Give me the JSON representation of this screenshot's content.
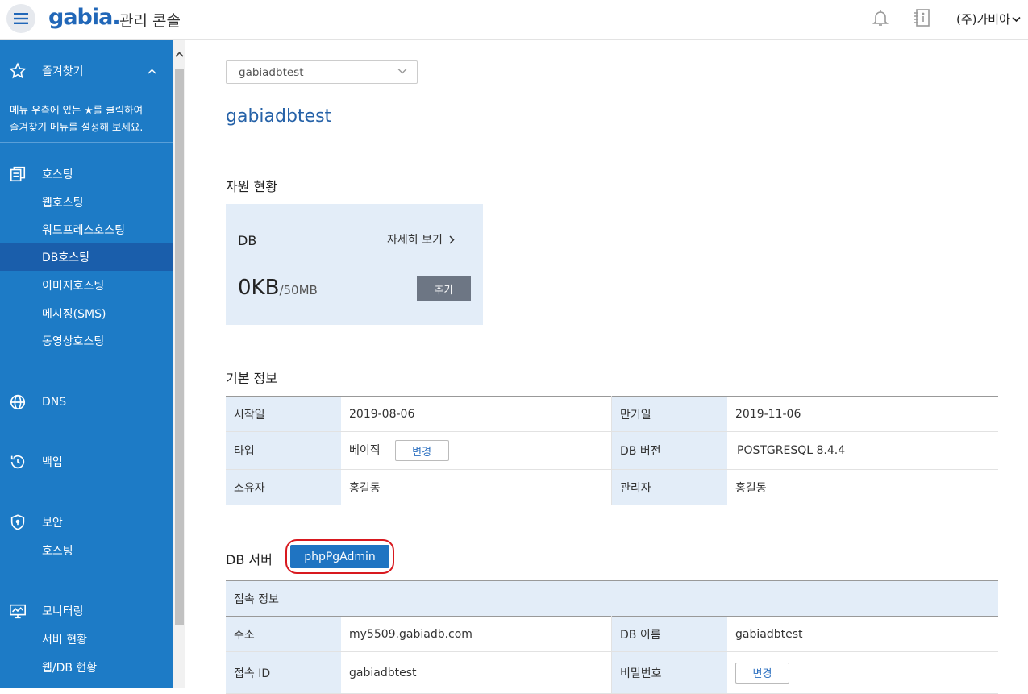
{
  "header": {
    "logo": "gabia.",
    "console_label": "관리 콘솔",
    "account": "(주)가비아"
  },
  "sidebar": {
    "favorites": {
      "label": "즐겨찾기",
      "note_line1": "메뉴 우측에 있는 ★를 클릭하여",
      "note_line2": "즐겨찾기 메뉴를 설정해 보세요."
    },
    "hosting": {
      "label": "호스팅",
      "items": [
        "웹호스팅",
        "워드프레스호스팅",
        "DB호스팅",
        "이미지호스팅",
        "메시징(SMS)",
        "동영상호스팅"
      ],
      "active": "DB호스팅"
    },
    "dns": {
      "label": "DNS"
    },
    "backup": {
      "label": "백업"
    },
    "security": {
      "label": "보안",
      "items": [
        "호스팅"
      ]
    },
    "monitoring": {
      "label": "모니터링",
      "items": [
        "서버 현황",
        "웹/DB 현황"
      ]
    }
  },
  "main": {
    "select_value": "gabiadbtest",
    "title": "gabiadbtest",
    "resource": {
      "section_title": "자원 현황",
      "db_label": "DB",
      "detail_link": "자세히 보기",
      "used": "0KB",
      "total": "/50MB",
      "add_button": "추가"
    },
    "basic_info": {
      "section_title": "기본 정보",
      "rows": [
        {
          "k1": "시작일",
          "v1": "2019-08-06",
          "k2": "만기일",
          "v2": "2019-11-06"
        },
        {
          "k1": "타입",
          "v1": "베이직",
          "k2": "DB 버전",
          "v2": "POSTGRESQL 8.4.4"
        },
        {
          "k1": "소유자",
          "v1": "홍길동",
          "k2": "관리자",
          "v2": "홍길동"
        }
      ],
      "change_button": "변경"
    },
    "db_server": {
      "section_title": "DB 서버",
      "pgadmin_button": "phpPgAdmin",
      "conn_header": "접속 정보",
      "rows": [
        {
          "k1": "주소",
          "v1": "my5509.gabiadb.com",
          "k2": "DB 이름",
          "v2": "gabiadbtest"
        },
        {
          "k1": "접속 ID",
          "v1": "gabiadbtest",
          "k2": "비밀번호",
          "v2": ""
        }
      ],
      "password_change_button": "변경"
    }
  },
  "colors": {
    "sidebar_bg": "#1d7bc6",
    "sidebar_active": "#1a5eab",
    "brand_blue": "#2167b8",
    "highlight_red": "#d8191f"
  },
  "icons": [
    "hamburger-icon",
    "bell-icon",
    "notice-book-icon",
    "chevron-down-icon",
    "star-icon",
    "hosting-icon",
    "globe-icon",
    "history-icon",
    "shield-icon",
    "monitor-icon",
    "chevron-right-icon"
  ]
}
